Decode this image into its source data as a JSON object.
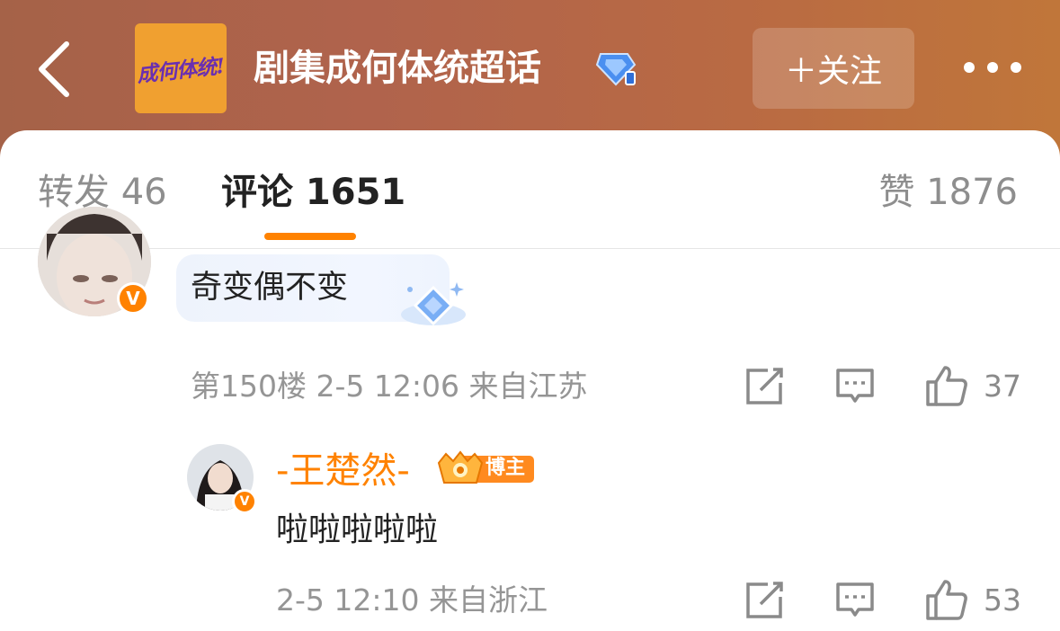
{
  "header": {
    "title": "剧集成何体统超话",
    "logo_text": "成何体统!",
    "follow_label": "＋关注",
    "accent_color": "#ff8200"
  },
  "tabs": [
    {
      "label": "转发 46"
    },
    {
      "label": "评论 1651"
    },
    {
      "label": "赞 1876"
    }
  ],
  "comments": [
    {
      "text": "奇变偶不变",
      "meta": "第150楼  2-5 12:06  来自江苏",
      "likes": "37",
      "verified_mark": "V"
    }
  ],
  "reply": {
    "name": "-王楚然-",
    "badge": "博主",
    "text": "啦啦啦啦啦",
    "meta": "2-5 12:10  来自浙江",
    "likes": "53",
    "verified_mark": "V"
  },
  "icons": [
    "back-arrow-icon",
    "super-topic-diamond-icon",
    "more-dots-icon",
    "share-icon",
    "comment-icon",
    "like-icon"
  ]
}
